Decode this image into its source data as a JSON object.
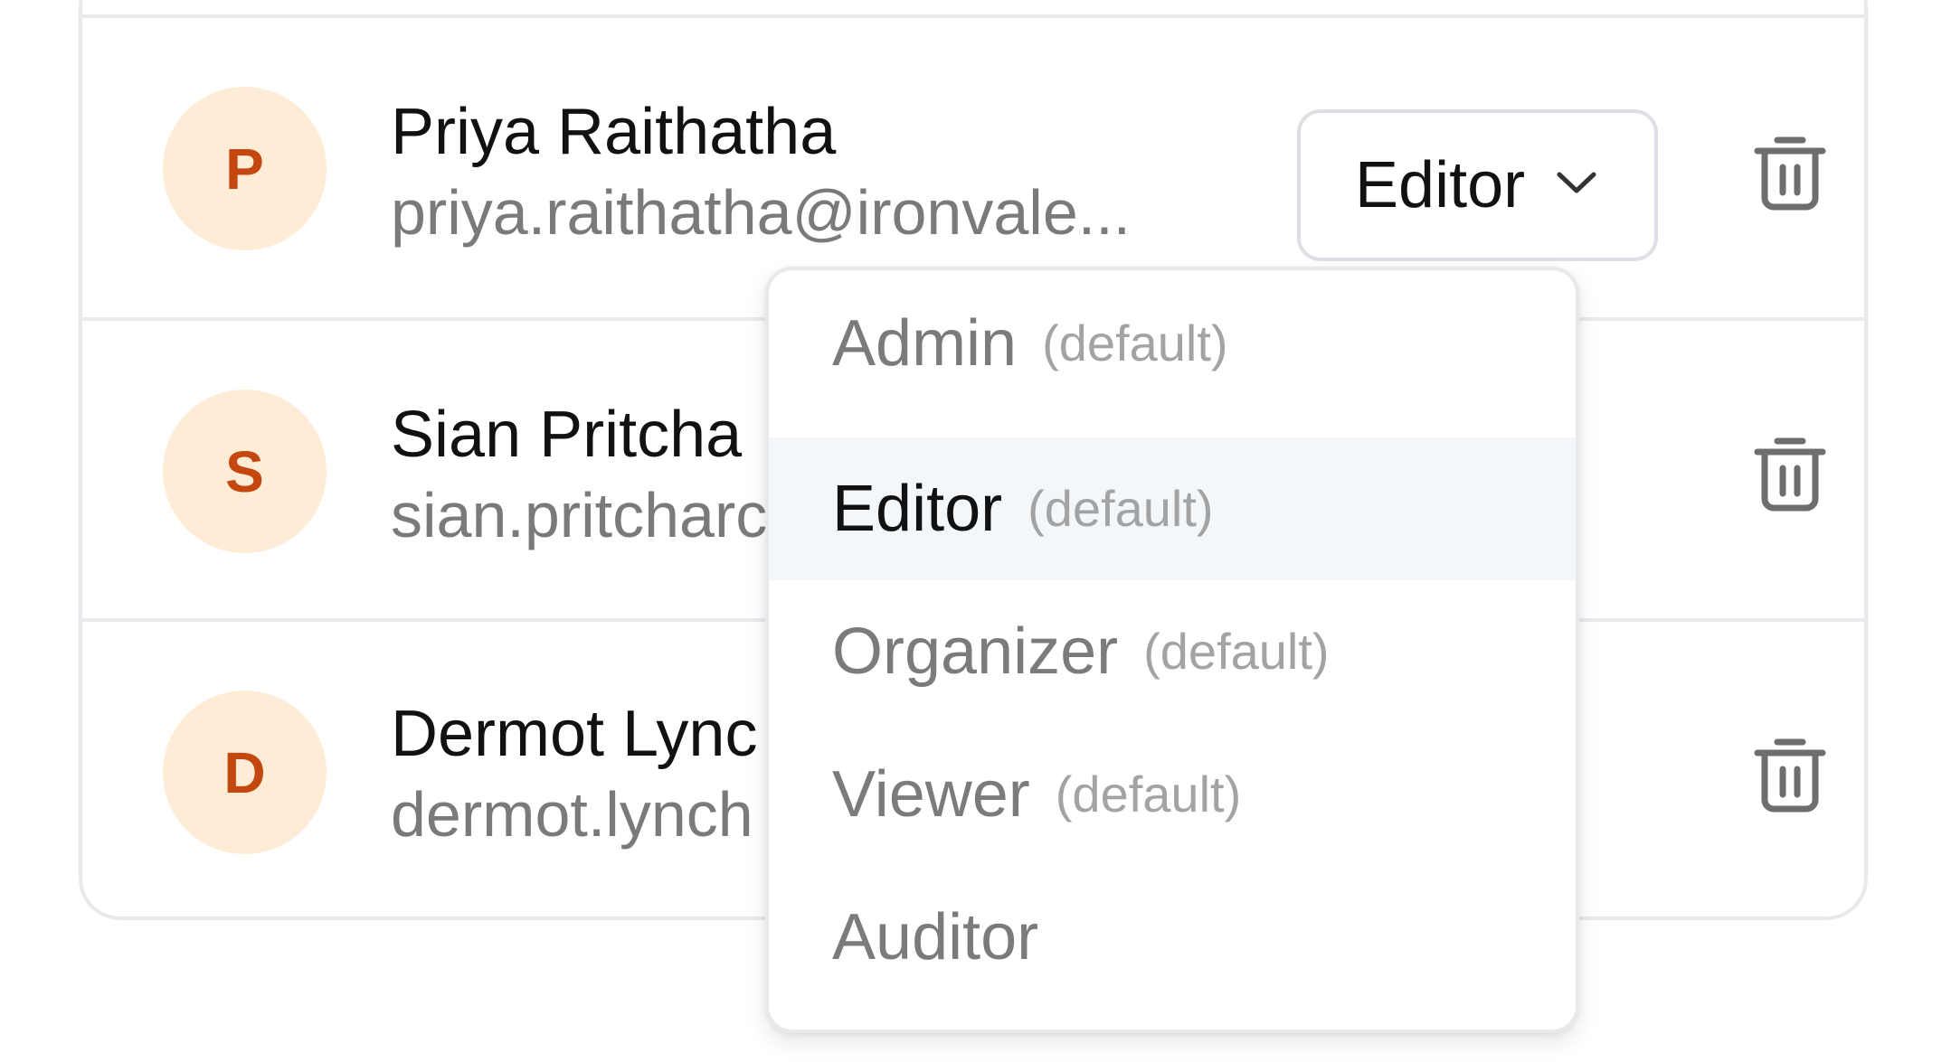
{
  "members": [
    {
      "initial": "P",
      "name": "Priya Raithatha",
      "email": "priya.raithatha@ironvale...",
      "role": "Editor"
    },
    {
      "initial": "S",
      "name": "Sian Pritcha",
      "email": "sian.pritcharc",
      "role": ""
    },
    {
      "initial": "D",
      "name": "Dermot Lync",
      "email": "dermot.lynch",
      "role": ""
    }
  ],
  "role_menu": {
    "options": [
      {
        "label": "Admin",
        "tag": "(default)",
        "selected": false
      },
      {
        "label": "Editor",
        "tag": "(default)",
        "selected": true
      },
      {
        "label": "Organizer",
        "tag": "(default)",
        "selected": false
      },
      {
        "label": "Viewer",
        "tag": "(default)",
        "selected": false
      },
      {
        "label": "Auditor",
        "tag": "",
        "selected": false
      }
    ]
  },
  "icons": {
    "delete": "trash-icon",
    "dropdown": "chevron-down-icon"
  },
  "colors": {
    "avatar_bg": "#feecd6",
    "avatar_text": "#c4470f",
    "highlight_bg": "#f4f7fa"
  }
}
